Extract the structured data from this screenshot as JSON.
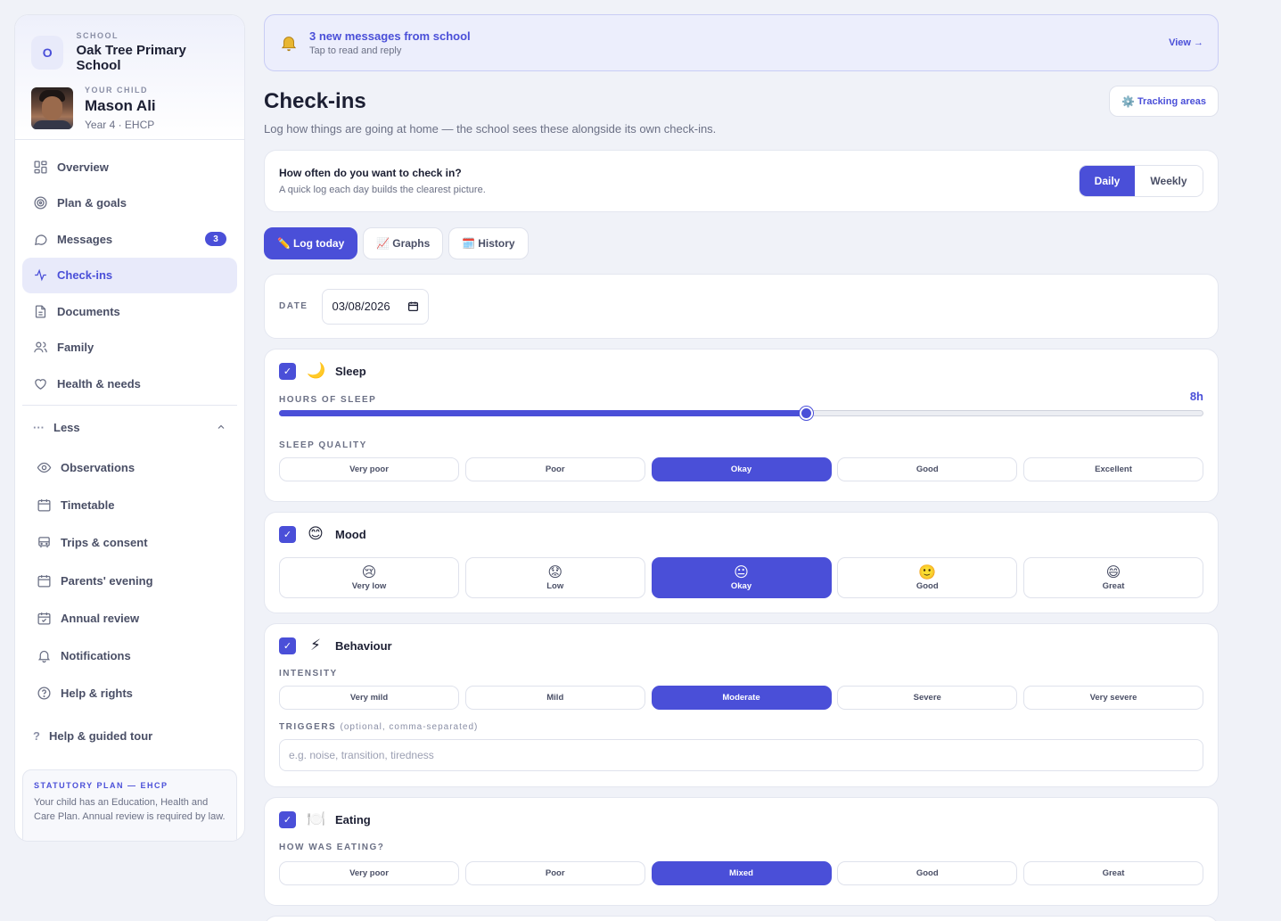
{
  "sidebar": {
    "school_caption": "SCHOOL",
    "school_initial": "O",
    "school_name": "Oak Tree Primary School",
    "child_caption": "YOUR CHILD",
    "child_name": "Mason Ali",
    "child_meta": "Year 4 · EHCP",
    "nav": [
      {
        "label": "Overview",
        "icon": "grid-icon"
      },
      {
        "label": "Plan & goals",
        "icon": "target-icon"
      },
      {
        "label": "Messages",
        "icon": "chat-icon",
        "badge": "3"
      },
      {
        "label": "Check-ins",
        "icon": "pulse-icon",
        "active": true
      },
      {
        "label": "Documents",
        "icon": "document-icon"
      },
      {
        "label": "Family",
        "icon": "people-icon"
      },
      {
        "label": "Health & needs",
        "icon": "heart-icon"
      }
    ],
    "less_dots": "···",
    "less_label": "Less",
    "sub_nav": [
      {
        "label": "Observations",
        "icon": "eye-icon"
      },
      {
        "label": "Timetable",
        "icon": "calendar-icon"
      },
      {
        "label": "Trips & consent",
        "icon": "bus-icon"
      },
      {
        "label": "Parents' evening",
        "icon": "calendar-icon"
      },
      {
        "label": "Annual review",
        "icon": "calendar-check-icon"
      },
      {
        "label": "Notifications",
        "icon": "bell-icon"
      },
      {
        "label": "Help & rights",
        "icon": "help-circle-icon"
      }
    ],
    "help_mark": "?",
    "help_label": "Help & guided tour",
    "ehcp_title": "STATUTORY PLAN — EHCP",
    "ehcp_body": "Your child has an Education, Health and Care Plan. Annual review is required by law."
  },
  "banner": {
    "title": "3 new messages from school",
    "subtitle": "Tap to read and reply",
    "link": "View →"
  },
  "header": {
    "title": "Check-ins",
    "subtitle": "Log how things are going at home — the school sees these alongside its own check-ins.",
    "tracking_icon": "⚙️",
    "tracking_button": "Tracking areas"
  },
  "frequency": {
    "title": "How often do you want to check in?",
    "subtitle": "A quick log each day builds the clearest picture.",
    "options": [
      "Daily",
      "Weekly"
    ],
    "selected": "Daily"
  },
  "tabs": [
    {
      "icon": "✏️",
      "label": "Log today",
      "active": true
    },
    {
      "icon": "📈",
      "label": "Graphs"
    },
    {
      "icon": "🗓️",
      "label": "History"
    }
  ],
  "date": {
    "label": "DATE",
    "value": "03/08/2026"
  },
  "sleep": {
    "emoji": "🌙",
    "title": "Sleep",
    "hours_label": "HOURS OF SLEEP",
    "hours_value": "8h",
    "hours_fraction": 0.57,
    "quality_label": "SLEEP QUALITY",
    "quality_options": [
      "Very poor",
      "Poor",
      "Okay",
      "Good",
      "Excellent"
    ],
    "quality_selected": "Okay"
  },
  "mood": {
    "emoji": "😊",
    "title": "Mood",
    "options": [
      {
        "emoji": "😢",
        "label": "Very low"
      },
      {
        "emoji": "😟",
        "label": "Low"
      },
      {
        "emoji": "😐",
        "label": "Okay",
        "selected": true
      },
      {
        "emoji": "🙂",
        "label": "Good"
      },
      {
        "emoji": "😄",
        "label": "Great"
      }
    ]
  },
  "behaviour": {
    "emoji": "⚡",
    "title": "Behaviour",
    "intensity_label": "INTENSITY",
    "intensity_options": [
      "Very mild",
      "Mild",
      "Moderate",
      "Severe",
      "Very severe"
    ],
    "intensity_selected": "Moderate",
    "triggers_label": "TRIGGERS",
    "triggers_hint": "(optional, comma-separated)",
    "triggers_placeholder": "e.g. noise, transition, tiredness"
  },
  "eating": {
    "emoji": "🍽️",
    "title": "Eating",
    "question": "HOW WAS EATING?",
    "options": [
      "Very poor",
      "Poor",
      "Mixed",
      "Good",
      "Great"
    ],
    "selected": "Mixed"
  },
  "check_mark": "✓",
  "colors": {
    "accent": "#4a4fd8",
    "background": "#f0f2f8"
  }
}
